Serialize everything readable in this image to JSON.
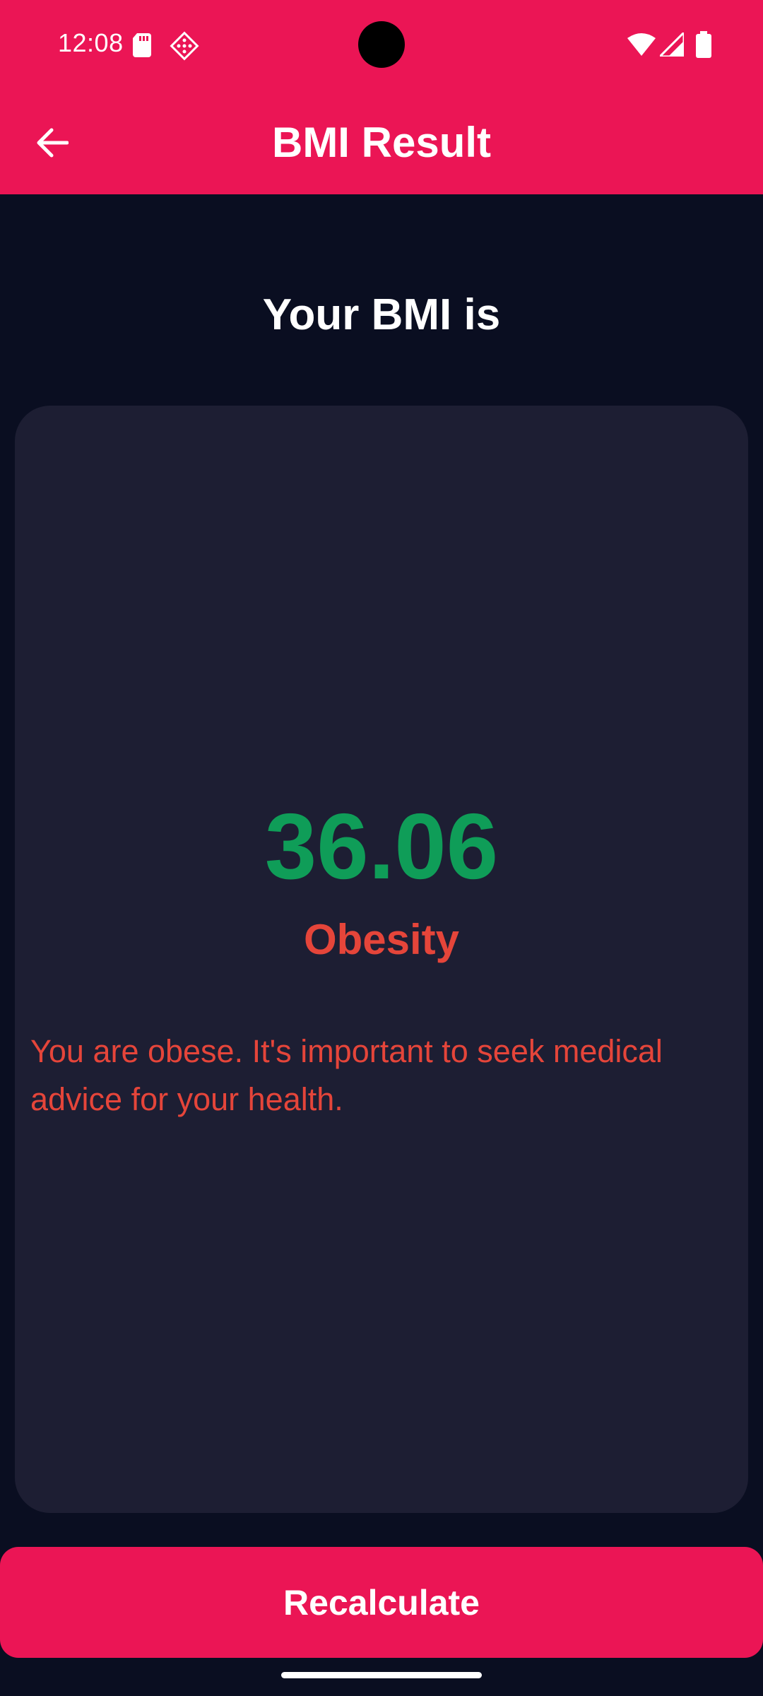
{
  "status_bar": {
    "time": "12:08",
    "icons": [
      "sd-card-icon",
      "diamond-pattern-icon",
      "wifi-icon",
      "cellular-signal-icon",
      "battery-icon"
    ]
  },
  "appbar": {
    "title": "BMI Result",
    "back_icon": "arrow-back-icon"
  },
  "heading": "Your BMI is",
  "result": {
    "value": "36.06",
    "category": "Obesity",
    "advice": "You are obese. It's important to seek medical advice for your health."
  },
  "actions": {
    "recalculate_label": "Recalculate"
  },
  "colors": {
    "primary": "#eb1555",
    "background": "#0a0e21",
    "card": "#1d1e33",
    "value_green": "#0f9d58",
    "warning_red": "#e5453a",
    "text_white": "#ffffff"
  }
}
